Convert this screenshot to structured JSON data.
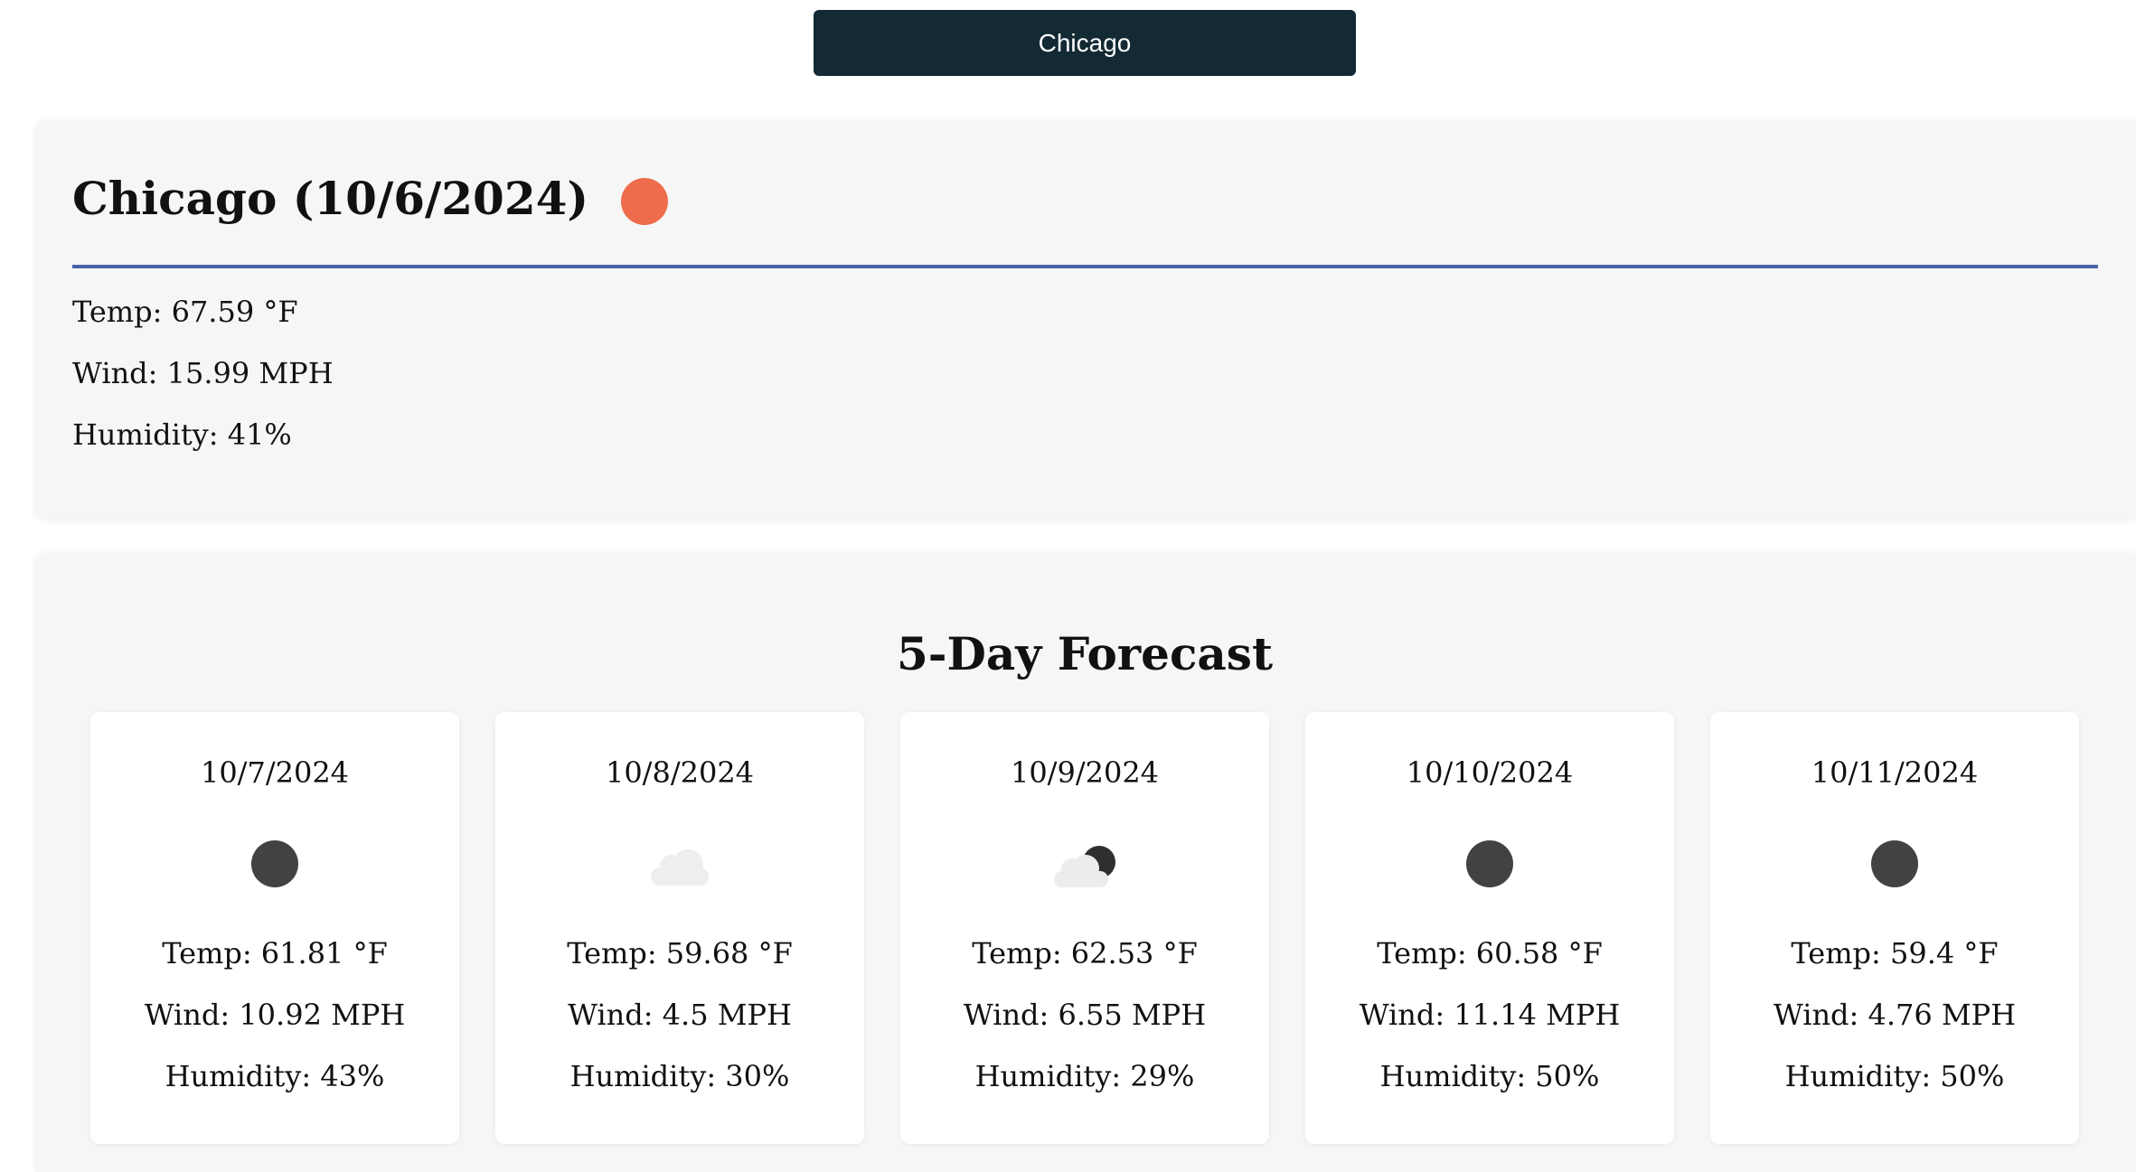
{
  "search_history": {
    "cities": [
      "Chicago"
    ]
  },
  "current": {
    "title": "Chicago (10/6/2024)",
    "icon": "sun-icon",
    "icon_color": "#ee6b4b",
    "temp": "Temp: 67.59 °F",
    "wind": "Wind: 15.99 MPH",
    "humidity": "Humidity: 41%"
  },
  "forecast": {
    "title": "5-Day Forecast",
    "days": [
      {
        "date": "10/7/2024",
        "icon": "dark-sun-icon",
        "temp": "Temp: 61.81 °F",
        "wind": "Wind: 10.92 MPH",
        "humidity": "Humidity: 43%"
      },
      {
        "date": "10/8/2024",
        "icon": "cloud-icon",
        "temp": "Temp: 59.68 °F",
        "wind": "Wind: 4.5 MPH",
        "humidity": "Humidity: 30%"
      },
      {
        "date": "10/9/2024",
        "icon": "partly-cloudy-icon",
        "temp": "Temp: 62.53 °F",
        "wind": "Wind: 6.55 MPH",
        "humidity": "Humidity: 29%"
      },
      {
        "date": "10/10/2024",
        "icon": "dark-sun-icon",
        "temp": "Temp: 60.58 °F",
        "wind": "Wind: 11.14 MPH",
        "humidity": "Humidity: 50%"
      },
      {
        "date": "10/11/2024",
        "icon": "dark-sun-icon",
        "temp": "Temp: 59.4 °F",
        "wind": "Wind: 4.76 MPH",
        "humidity": "Humidity: 50%"
      }
    ]
  },
  "colors": {
    "button_bg": "#132a34",
    "divider": "#4a63a8",
    "card_bg": "#f5f6f5"
  }
}
